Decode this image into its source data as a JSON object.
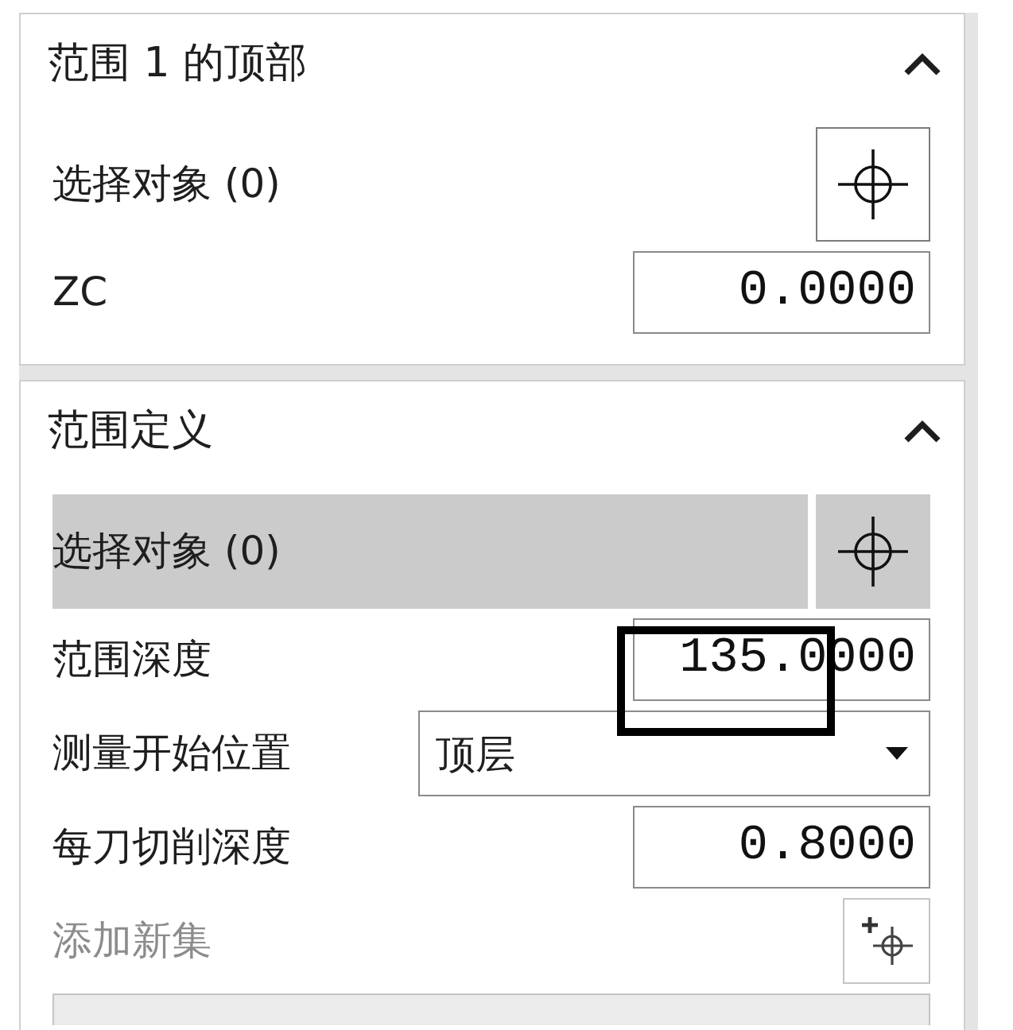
{
  "sections": [
    {
      "title": "范围 1 的顶部",
      "expanded": true,
      "rows": [
        {
          "kind": "select",
          "label": "选择对象 (0)",
          "selected": false
        },
        {
          "kind": "number",
          "label": "ZC",
          "value": "0.0000",
          "highlighted": false
        }
      ]
    },
    {
      "title": "范围定义",
      "expanded": true,
      "rows": [
        {
          "kind": "select",
          "label": "选择对象 (0)",
          "selected": true
        },
        {
          "kind": "number",
          "label": "范围深度",
          "value": "135.0000",
          "highlighted": true
        },
        {
          "kind": "dropdown",
          "label": "测量开始位置",
          "value": "顶层"
        },
        {
          "kind": "number",
          "label": "每刀切削深度",
          "value": "0.8000",
          "highlighted": false
        },
        {
          "kind": "add",
          "label": "添加新集",
          "disabled": true
        },
        {
          "kind": "list"
        }
      ]
    }
  ]
}
